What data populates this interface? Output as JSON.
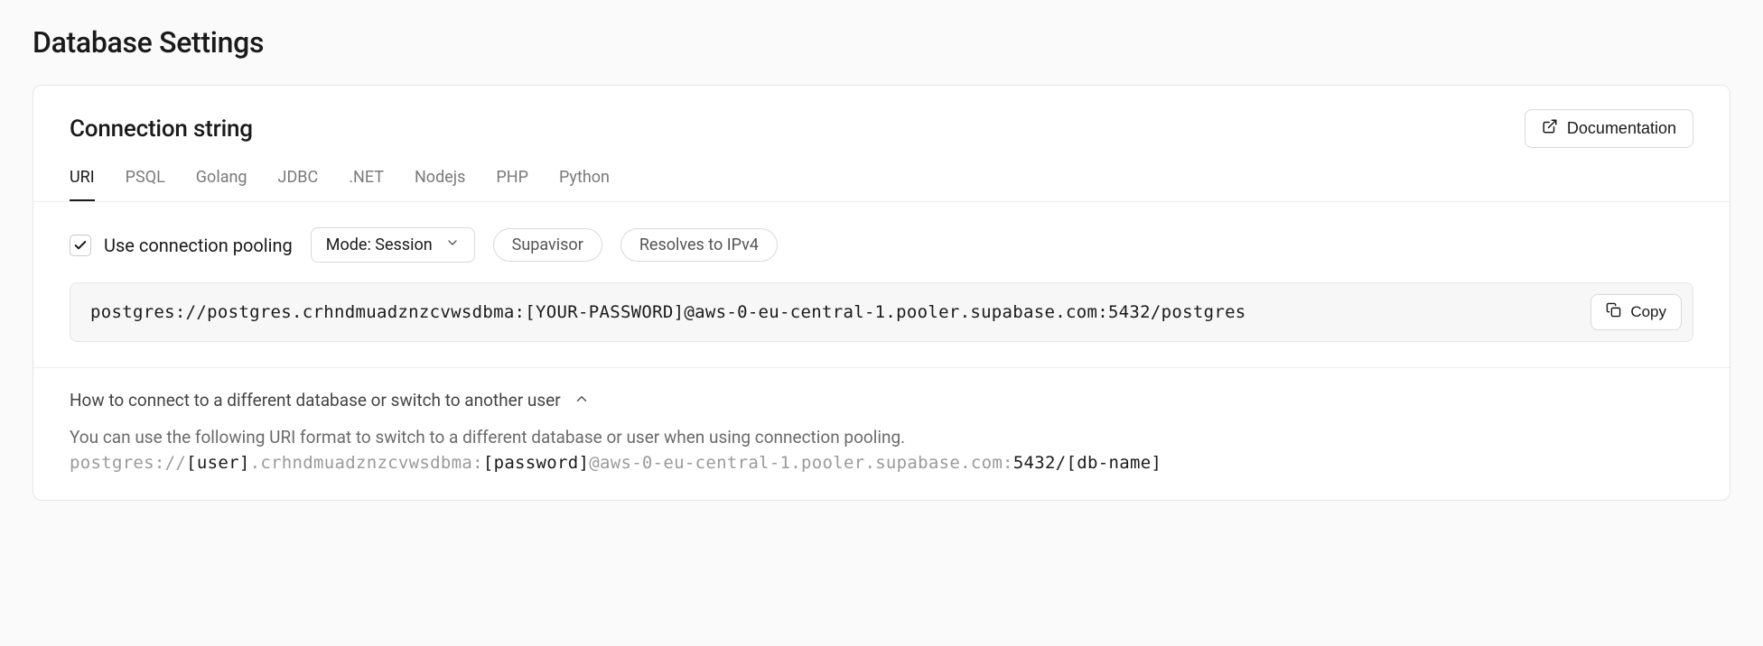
{
  "page": {
    "title": "Database Settings"
  },
  "section": {
    "heading": "Connection string",
    "doc_button": "Documentation"
  },
  "tabs": {
    "items": [
      "URI",
      "PSQL",
      "Golang",
      "JDBC",
      ".NET",
      "Nodejs",
      "PHP",
      "Python"
    ],
    "active_index": 0
  },
  "pooling": {
    "checked": true,
    "label": "Use connection pooling",
    "mode_label": "Mode: Session",
    "pills": [
      "Supavisor",
      "Resolves to IPv4"
    ]
  },
  "connection": {
    "string": "postgres://postgres.crhndmuadznzcvwsdbma:[YOUR-PASSWORD]@aws-0-eu-central-1.pooler.supabase.com:5432/postgres",
    "copy_label": "Copy"
  },
  "expand": {
    "title": "How to connect to a different database or switch to another user",
    "desc": "You can use the following URI format to switch to a different database or user when using connection pooling.",
    "uri_parts": {
      "p0": "postgres://",
      "p1": "[user]",
      "p2": ".crhndmuadznzcvwsdbma:",
      "p3": "[password]",
      "p4": "@aws-0-eu-central-1",
      "p5": ".pooler.supabase.com:",
      "p6": "5432/",
      "p7": "[db-name]"
    }
  }
}
